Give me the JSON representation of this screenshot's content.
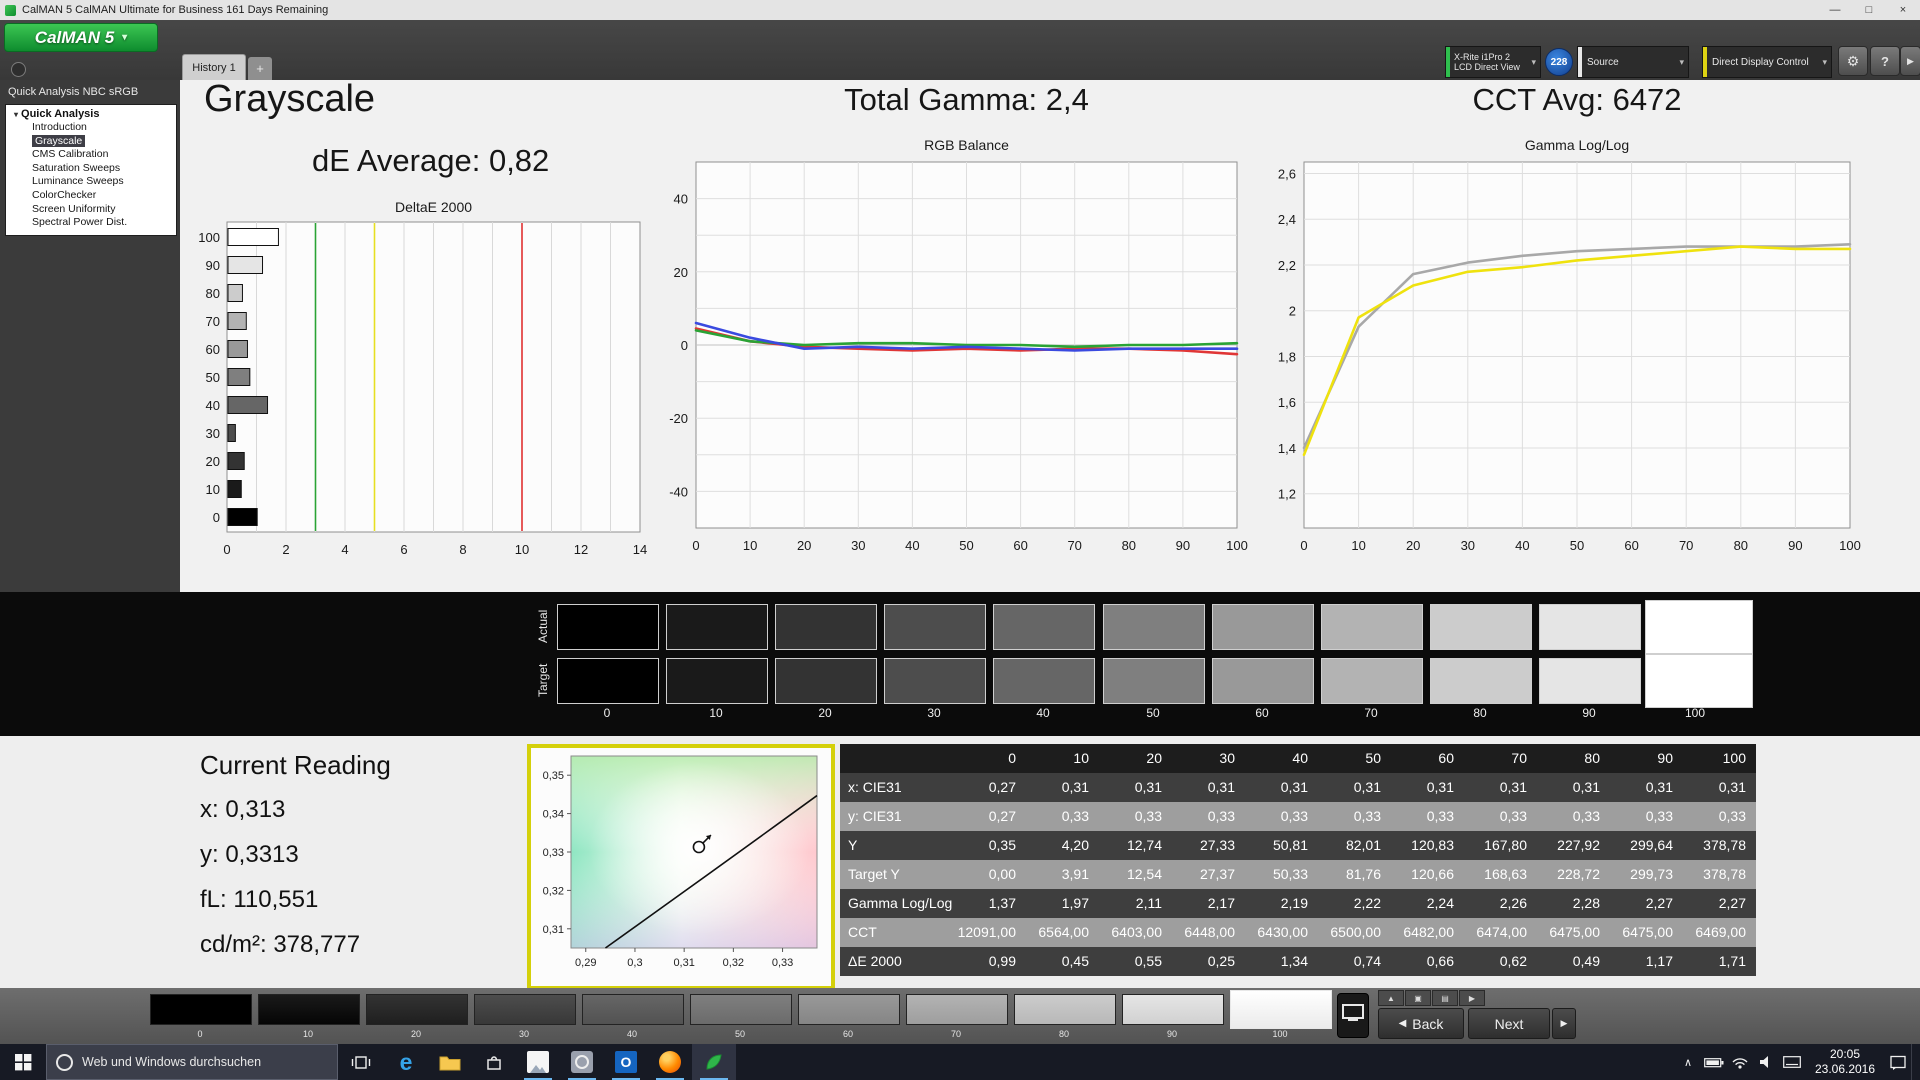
{
  "window": {
    "title": "CalMAN 5 CalMAN Ultimate for Business 161 Days Remaining",
    "controls": {
      "minimize": "—",
      "maximize": "□",
      "close": "×"
    }
  },
  "toolbar": {
    "logo": "CalMAN 5",
    "history_tab": "History 1",
    "add_tab": "+",
    "meter": {
      "line1": "X-Rite i1Pro 2",
      "line2": "LCD Direct View",
      "badge": "228"
    },
    "source": "Source",
    "display_control": "Direct Display Control",
    "stripe_colors": {
      "meter": "#2fbf4e",
      "source": "#e8e8e8",
      "display_control": "#ddd313"
    }
  },
  "sidebar": {
    "header": "Quick Analysis NBC sRGB",
    "root": "Quick Analysis",
    "items": [
      {
        "label": "Introduction",
        "selected": false
      },
      {
        "label": "Grayscale",
        "selected": true
      },
      {
        "label": "CMS Calibration",
        "selected": false
      },
      {
        "label": "Saturation Sweeps",
        "selected": false
      },
      {
        "label": "Luminance Sweeps",
        "selected": false
      },
      {
        "label": "ColorChecker",
        "selected": false
      },
      {
        "label": "Screen Uniformity",
        "selected": false
      },
      {
        "label": "Spectral Power Dist.",
        "selected": false
      }
    ]
  },
  "headings": {
    "page_title": "Grayscale",
    "de_average": "dE Average: 0,82",
    "total_gamma": "Total Gamma: 2,4",
    "cct_avg": "CCT Avg: 6472"
  },
  "chart_data": [
    {
      "type": "bar",
      "orientation": "horizontal",
      "title": "DeltaE 2000",
      "categories": [
        0,
        10,
        20,
        30,
        40,
        50,
        60,
        70,
        80,
        90,
        100
      ],
      "values": [
        0.99,
        0.45,
        0.55,
        0.25,
        1.34,
        0.74,
        0.66,
        0.62,
        0.49,
        1.17,
        1.71
      ],
      "xlim": [
        0,
        14
      ],
      "x_ticks": [
        0,
        2,
        4,
        6,
        8,
        10,
        12,
        14
      ],
      "x_grid_step": 1,
      "bar_fill": "grayscale-by-level",
      "reference_lines": [
        {
          "x": 3,
          "color": "#2aa335"
        },
        {
          "x": 5,
          "color": "#e6df21"
        },
        {
          "x": 10,
          "color": "#e03232"
        }
      ]
    },
    {
      "type": "line",
      "title": "RGB Balance",
      "x": [
        0,
        10,
        20,
        30,
        40,
        50,
        60,
        70,
        80,
        90,
        100
      ],
      "xlim": [
        0,
        100
      ],
      "x_ticks": [
        0,
        10,
        20,
        30,
        40,
        50,
        60,
        70,
        80,
        90,
        100
      ],
      "x_grid_step": 10,
      "ylim": [
        -50,
        50
      ],
      "y_ticks": [
        -40,
        -20,
        0,
        20,
        40
      ],
      "y_grid_step": 10,
      "series": [
        {
          "name": "Red",
          "color": "#e03636",
          "values": [
            4.5,
            1,
            -0.5,
            -1,
            -1.5,
            -1,
            -1.5,
            -1,
            -1,
            -1.5,
            -2.5
          ]
        },
        {
          "name": "Green",
          "color": "#2aa335",
          "values": [
            4,
            1,
            0,
            0.5,
            0.5,
            0,
            0,
            -0.5,
            0,
            0,
            0.5
          ]
        },
        {
          "name": "Blue",
          "color": "#3a4ae0",
          "values": [
            6,
            2,
            -1,
            -0.5,
            -1,
            -0.5,
            -1,
            -1.5,
            -1,
            -1,
            -1
          ]
        }
      ]
    },
    {
      "type": "line",
      "title": "Gamma Log/Log",
      "x": [
        0,
        10,
        20,
        30,
        40,
        50,
        60,
        70,
        80,
        90,
        100
      ],
      "xlim": [
        0,
        100
      ],
      "x_ticks": [
        0,
        10,
        20,
        30,
        40,
        50,
        60,
        70,
        80,
        90,
        100
      ],
      "x_grid_step": 10,
      "ylim": [
        1.05,
        2.65
      ],
      "y_ticks": [
        1.2,
        1.4,
        1.6,
        1.8,
        2,
        2.2,
        2.4,
        2.6
      ],
      "y_grid_step": 0.2,
      "series": [
        {
          "name": "Target",
          "color": "#a8a8a8",
          "values": [
            1.4,
            1.93,
            2.16,
            2.21,
            2.24,
            2.26,
            2.27,
            2.28,
            2.28,
            2.28,
            2.29
          ]
        },
        {
          "name": "Measured",
          "color": "#efe20e",
          "values": [
            1.37,
            1.97,
            2.11,
            2.17,
            2.19,
            2.22,
            2.24,
            2.26,
            2.28,
            2.27,
            2.27
          ]
        }
      ]
    },
    {
      "type": "scatter",
      "title": "CIE 1931 chromaticity",
      "xlim": [
        0.287,
        0.337
      ],
      "ylim": [
        0.305,
        0.355
      ],
      "x_ticks": [
        0.29,
        0.3,
        0.31,
        0.32,
        0.33
      ],
      "x_tick_labels": [
        "0,29",
        "0,3",
        "0,31",
        "0,32",
        "0,33"
      ],
      "y_ticks": [
        0.31,
        0.32,
        0.33,
        0.34,
        0.35
      ],
      "y_tick_labels": [
        "0,31",
        "0,32",
        "0,33",
        "0,34",
        "0,35"
      ],
      "point": {
        "x": 0.313,
        "y": 0.3313
      },
      "locus": [
        [
          0.294,
          0.305
        ],
        [
          0.318,
          0.327
        ],
        [
          0.337,
          0.3447
        ]
      ]
    }
  ],
  "gray_ramp": {
    "row_labels": [
      "Actual",
      "Target"
    ],
    "levels": [
      0,
      10,
      20,
      30,
      40,
      50,
      60,
      70,
      80,
      90,
      100
    ],
    "selected_level": 100
  },
  "current_reading": {
    "title": "Current Reading",
    "lines": [
      "x: 0,313",
      "y: 0,3313",
      "fL: 110,551",
      "cd/m²: 378,777"
    ]
  },
  "results_table": {
    "columns": [
      "0",
      "10",
      "20",
      "30",
      "40",
      "50",
      "60",
      "70",
      "80",
      "90",
      "100"
    ],
    "rows": [
      {
        "label": "x: CIE31",
        "values": [
          "0,27",
          "0,31",
          "0,31",
          "0,31",
          "0,31",
          "0,31",
          "0,31",
          "0,31",
          "0,31",
          "0,31",
          "0,31"
        ]
      },
      {
        "label": "y: CIE31",
        "values": [
          "0,27",
          "0,33",
          "0,33",
          "0,33",
          "0,33",
          "0,33",
          "0,33",
          "0,33",
          "0,33",
          "0,33",
          "0,33"
        ]
      },
      {
        "label": "Y",
        "values": [
          "0,35",
          "4,20",
          "12,74",
          "27,33",
          "50,81",
          "82,01",
          "120,83",
          "167,80",
          "227,92",
          "299,64",
          "378,78"
        ]
      },
      {
        "label": "Target Y",
        "values": [
          "0,00",
          "3,91",
          "12,54",
          "27,37",
          "50,33",
          "81,76",
          "120,66",
          "168,63",
          "228,72",
          "299,73",
          "378,78"
        ]
      },
      {
        "label": "Gamma Log/Log",
        "values": [
          "1,37",
          "1,97",
          "2,11",
          "2,17",
          "2,19",
          "2,22",
          "2,24",
          "2,26",
          "2,28",
          "2,27",
          "2,27"
        ]
      },
      {
        "label": "CCT",
        "values": [
          "12091,00",
          "6564,00",
          "6403,00",
          "6448,00",
          "6430,00",
          "6500,00",
          "6482,00",
          "6474,00",
          "6475,00",
          "6475,00",
          "6469,00"
        ]
      },
      {
        "label": "ΔE 2000",
        "values": [
          "0,99",
          "0,45",
          "0,55",
          "0,25",
          "1,34",
          "0,74",
          "0,66",
          "0,62",
          "0,49",
          "1,17",
          "1,71"
        ]
      }
    ]
  },
  "pattern_strip": {
    "levels": [
      0,
      10,
      20,
      30,
      40,
      50,
      60,
      70,
      80,
      90,
      100
    ],
    "selected_level": 100,
    "mini_buttons": [
      {
        "name": "eject-icon",
        "glyph": "▲"
      },
      {
        "name": "grid-icon",
        "glyph": "▣"
      },
      {
        "name": "rows-icon",
        "glyph": "▤"
      },
      {
        "name": "play-icon",
        "glyph": "▶"
      }
    ],
    "back_label": "Back",
    "next_label": "Next"
  },
  "taskbar": {
    "search_placeholder": "Web und Windows durchsuchen",
    "time": "20:05",
    "date": "23.06.2016"
  }
}
